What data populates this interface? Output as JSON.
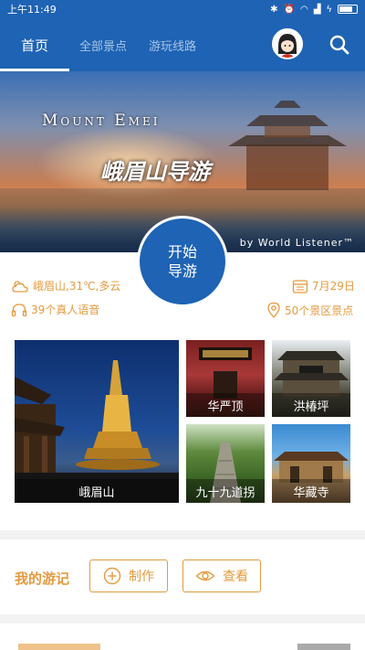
{
  "status_bar": {
    "time": "上午11:49"
  },
  "nav": {
    "tabs": [
      "首页",
      "全部景点",
      "游玩线路"
    ]
  },
  "banner": {
    "title_en": "Mount Emei",
    "title_cn": "峨眉山导游",
    "credit": "by World Listener™"
  },
  "start_button": {
    "line1": "开始",
    "line2": "导游"
  },
  "info": {
    "weather": "峨眉山,31℃,多云",
    "date": "7月29日",
    "audio": "39个真人语音",
    "spots": "50个景区景点"
  },
  "tiles": [
    {
      "label": "峨眉山"
    },
    {
      "label": "华严顶"
    },
    {
      "label": "洪椿坪"
    },
    {
      "label": "九十九道拐"
    },
    {
      "label": "华藏寺"
    }
  ],
  "journal": {
    "title": "我的游记",
    "create_label": "制作",
    "view_label": "查看"
  },
  "colors": {
    "primary": "#1e63b4",
    "accent": "#e59a3e"
  }
}
